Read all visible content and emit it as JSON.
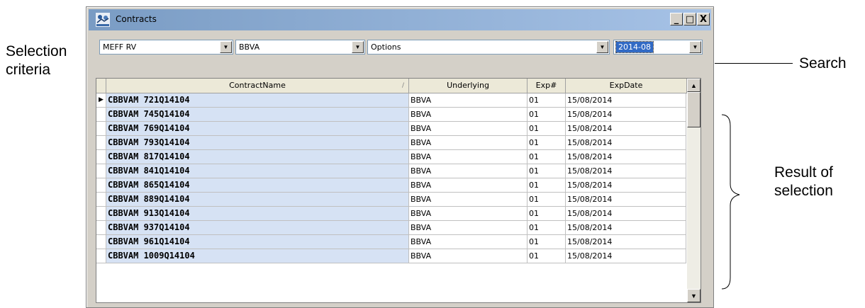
{
  "annotations": {
    "selection_criteria": "Selection criteria",
    "search": "Search",
    "result_of_selection": "Result of selection"
  },
  "window": {
    "title": "Contracts",
    "icon": "meff-app-icon",
    "controls": {
      "minimize": "_",
      "maximize": "□",
      "close": "X"
    }
  },
  "filters": {
    "market": "MEFF RV",
    "underlying": "BBVA",
    "instrument_type": "Options",
    "expiry": "2014-08"
  },
  "grid": {
    "columns": [
      "ContractName",
      "Underlying",
      "Exp#",
      "ExpDate"
    ],
    "sort_column": "ContractName",
    "sort_indicator": "/",
    "current_row_indicator": "▶",
    "rows": [
      {
        "name": "CBBVAM  721Q14104",
        "underlying": "BBVA",
        "exp": "01",
        "date": "15/08/2014"
      },
      {
        "name": "CBBVAM  745Q14104",
        "underlying": "BBVA",
        "exp": "01",
        "date": "15/08/2014"
      },
      {
        "name": "CBBVAM  769Q14104",
        "underlying": "BBVA",
        "exp": "01",
        "date": "15/08/2014"
      },
      {
        "name": "CBBVAM  793Q14104",
        "underlying": "BBVA",
        "exp": "01",
        "date": "15/08/2014"
      },
      {
        "name": "CBBVAM  817Q14104",
        "underlying": "BBVA",
        "exp": "01",
        "date": "15/08/2014"
      },
      {
        "name": "CBBVAM  841Q14104",
        "underlying": "BBVA",
        "exp": "01",
        "date": "15/08/2014"
      },
      {
        "name": "CBBVAM  865Q14104",
        "underlying": "BBVA",
        "exp": "01",
        "date": "15/08/2014"
      },
      {
        "name": "CBBVAM  889Q14104",
        "underlying": "BBVA",
        "exp": "01",
        "date": "15/08/2014"
      },
      {
        "name": "CBBVAM  913Q14104",
        "underlying": "BBVA",
        "exp": "01",
        "date": "15/08/2014"
      },
      {
        "name": "CBBVAM  937Q14104",
        "underlying": "BBVA",
        "exp": "01",
        "date": "15/08/2014"
      },
      {
        "name": "CBBVAM  961Q14104",
        "underlying": "BBVA",
        "exp": "01",
        "date": "15/08/2014"
      },
      {
        "name": "CBBVAM 1009Q14104",
        "underlying": "BBVA",
        "exp": "01",
        "date": "15/08/2014"
      }
    ]
  },
  "colors": {
    "titlebar_start": "#7a9cc4",
    "titlebar_end": "#a6c2e6",
    "name_column_bg": "#d6e2f4",
    "selection_highlight": "#316ac5"
  }
}
